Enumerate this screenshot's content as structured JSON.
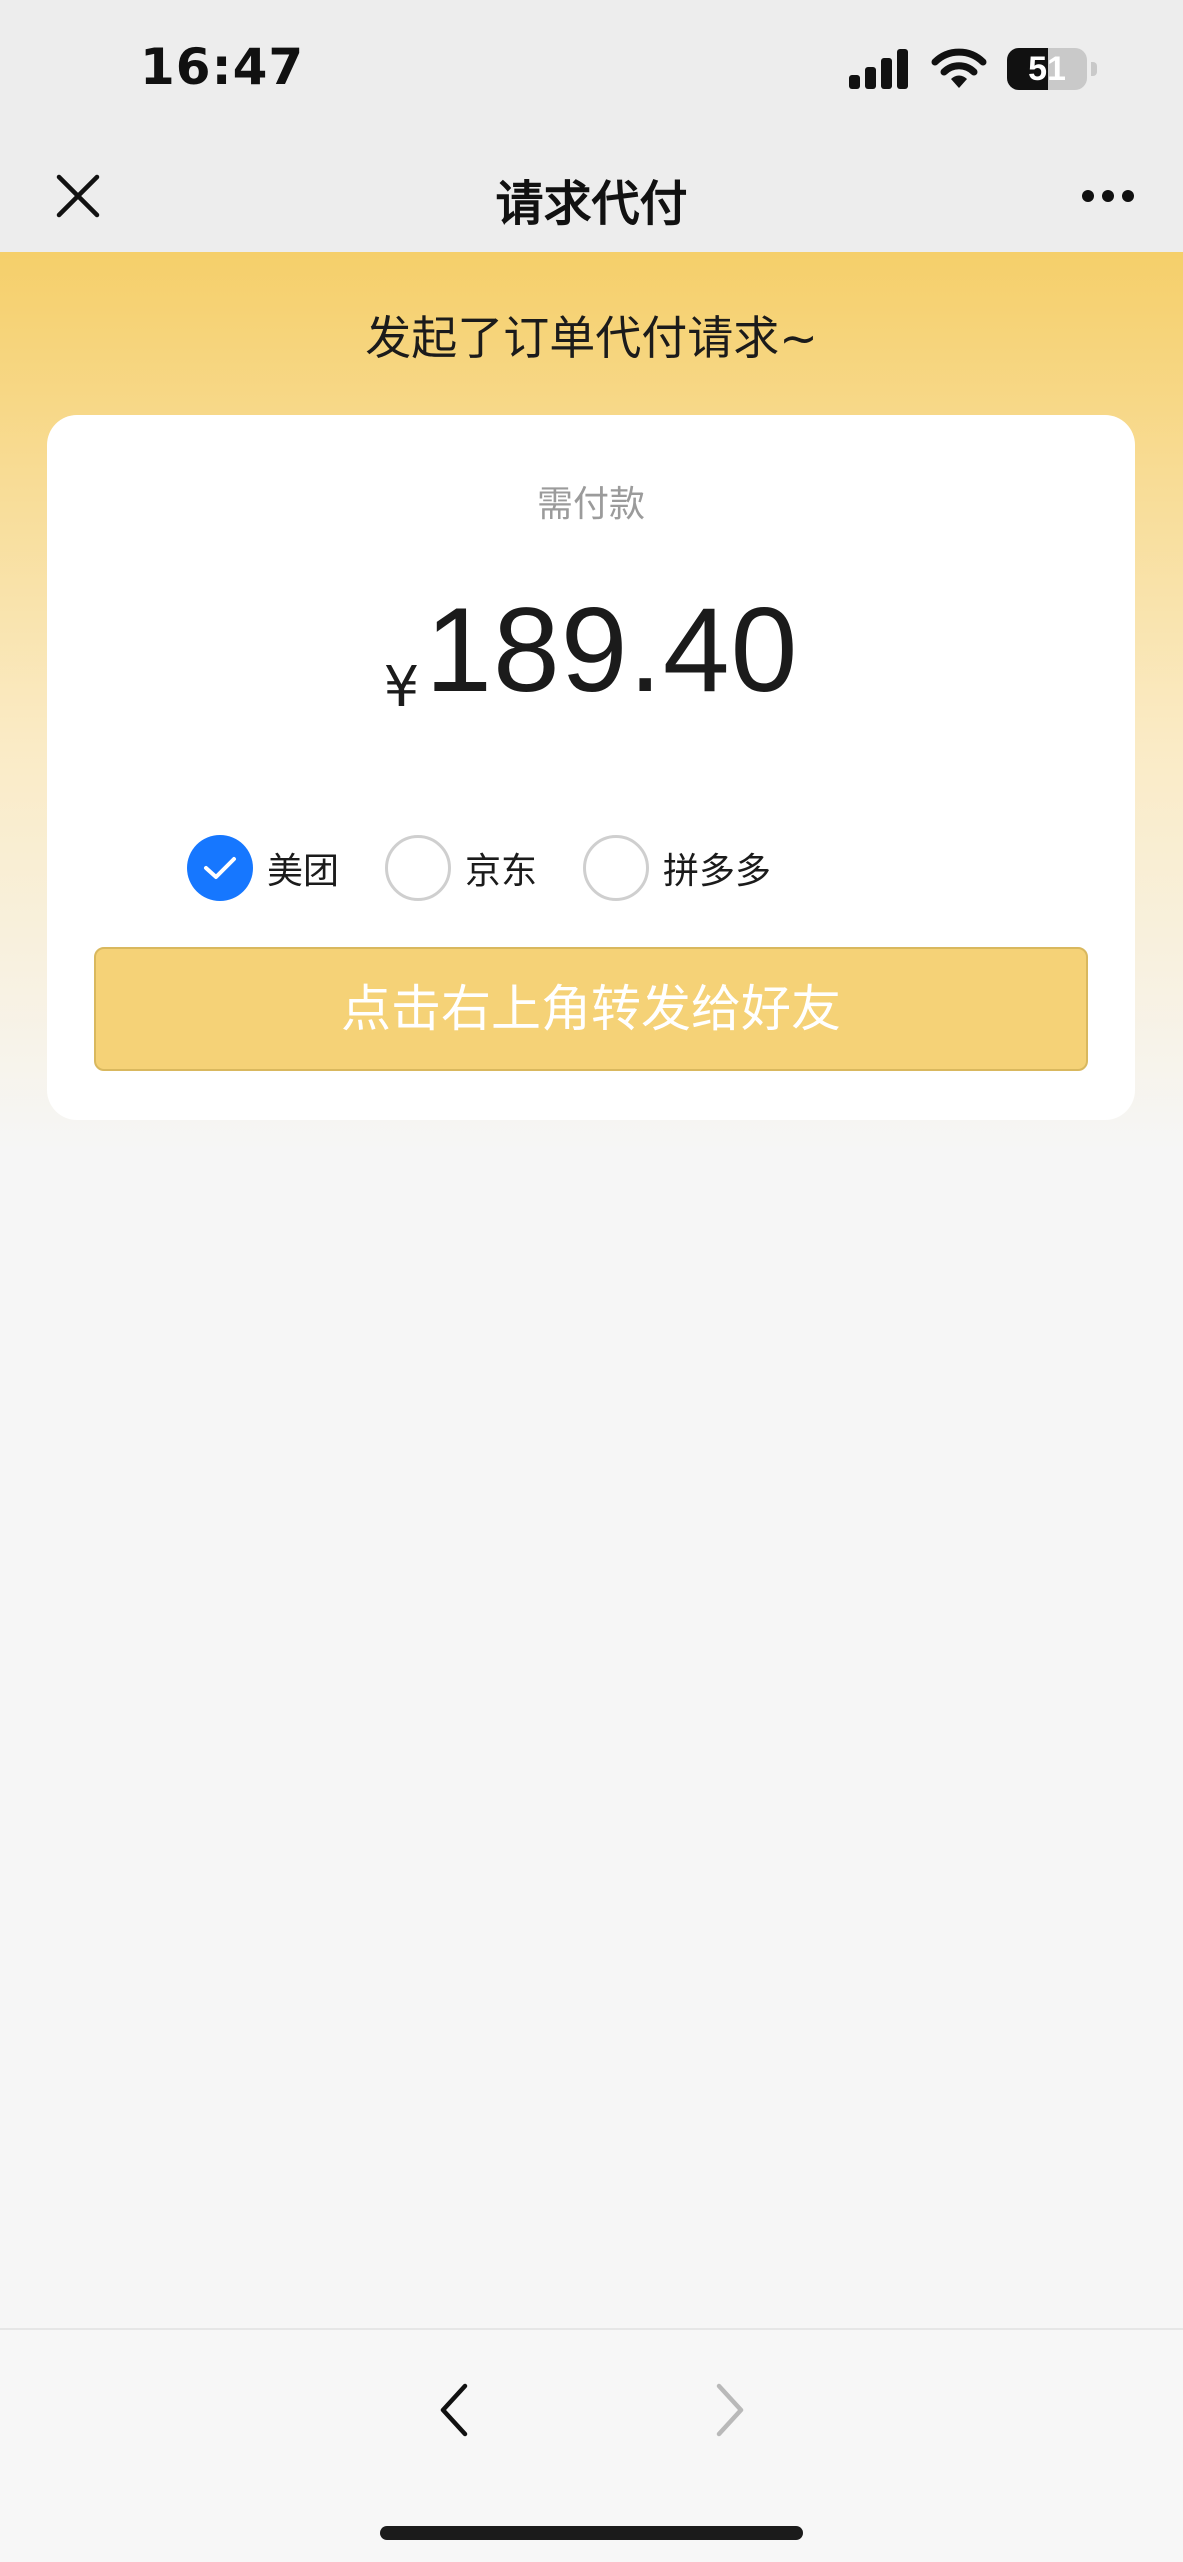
{
  "status_bar": {
    "time": "16:47",
    "battery_level": "51",
    "battery_fraction": 0.51,
    "icons": [
      "signal-icon",
      "wifi-icon",
      "battery-icon"
    ]
  },
  "nav": {
    "title": "请求代付",
    "close_icon": "close-icon",
    "more_icon": "more-icon"
  },
  "banner": {
    "message": "发起了订单代付请求~"
  },
  "payment": {
    "label": "需付款",
    "currency": "¥",
    "amount": "189.40"
  },
  "platforms": [
    {
      "label": "美团",
      "selected": true
    },
    {
      "label": "京东",
      "selected": false
    },
    {
      "label": "拼多多",
      "selected": false
    }
  ],
  "share_button": {
    "label": "点击右上角转发给好友"
  },
  "toolbar": {
    "back_icon": "chevron-left-icon",
    "forward_icon": "chevron-right-icon",
    "forward_enabled": false
  },
  "colors": {
    "accent": "#1677ff",
    "banner_yellow": "#f5cf6a",
    "button_yellow": "#f5d277"
  }
}
